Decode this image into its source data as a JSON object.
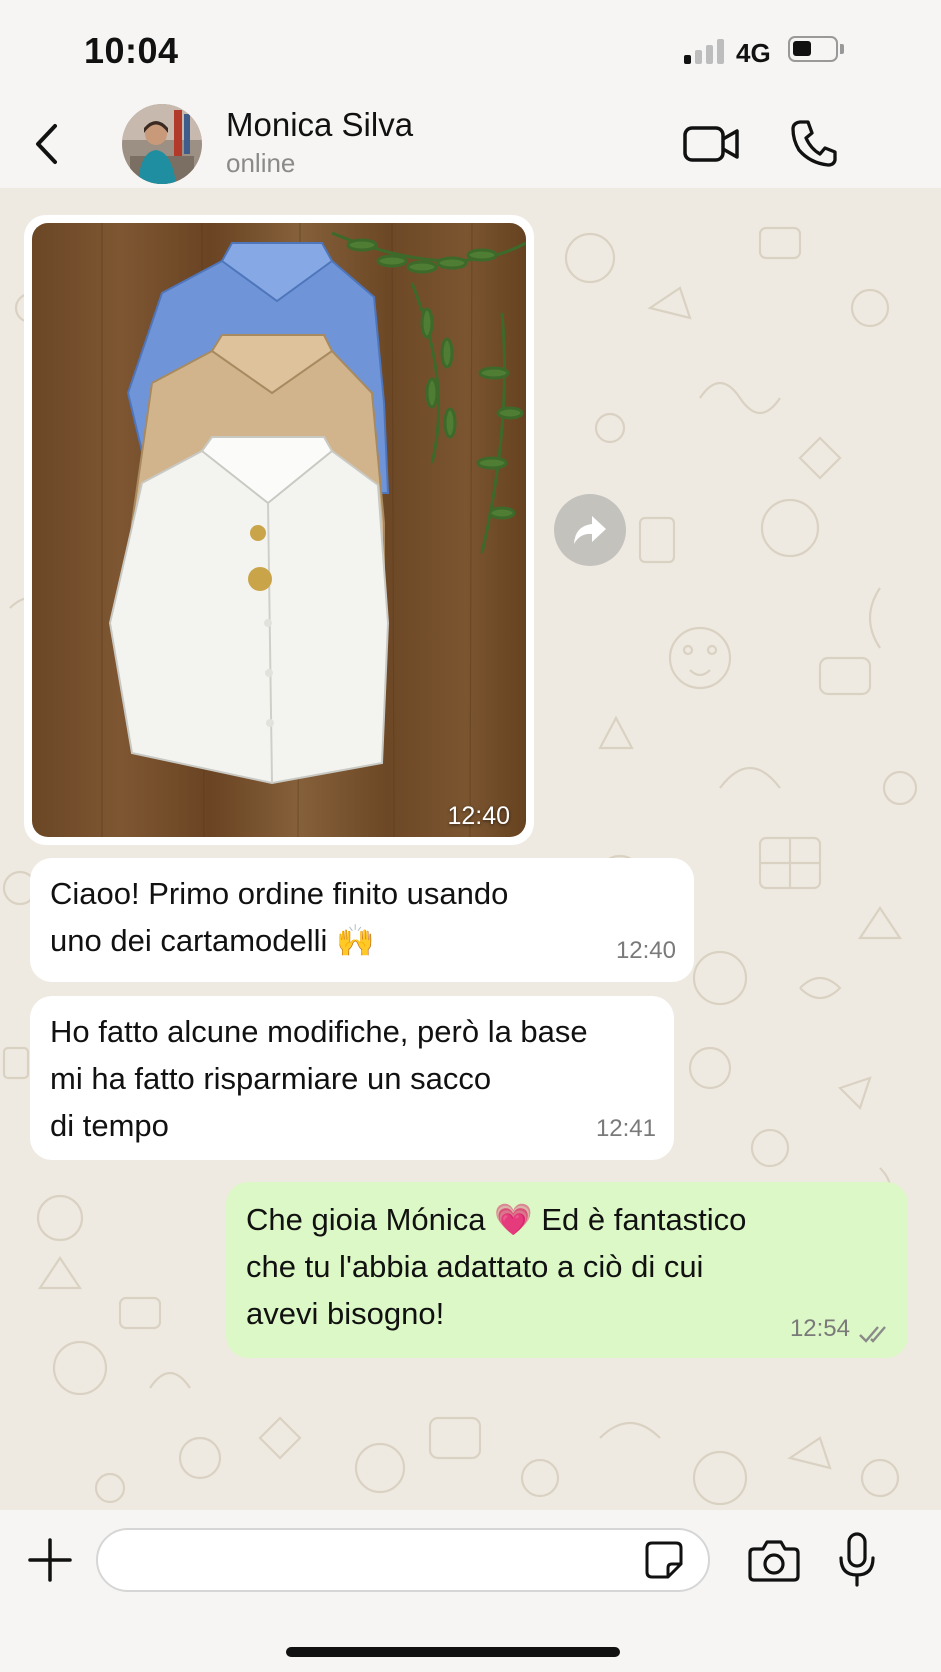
{
  "status_bar": {
    "time": "10:04",
    "network": "4G",
    "signal_bars_active": 1,
    "signal_bars_total": 4,
    "battery_level": 0.4
  },
  "header": {
    "contact_name": "Monica Silva",
    "contact_status": "online",
    "icons": [
      "chevron-left-icon",
      "video-camera-icon",
      "phone-icon"
    ]
  },
  "messages": [
    {
      "type": "image",
      "direction": "incoming",
      "time": "12:40",
      "image_subject": "three sleeveless shirts (blue, beige, white) on wooden table with fern"
    },
    {
      "type": "text",
      "direction": "incoming",
      "text": "Ciaoo! Primo ordine finito usando\nuno dei cartamodelli 🙌",
      "time": "12:40"
    },
    {
      "type": "text",
      "direction": "incoming",
      "text": "Ho fatto alcune modifiche, però la base\nmi ha fatto risparmiare un sacco\ndi tempo",
      "time": "12:41"
    },
    {
      "type": "text",
      "direction": "outgoing",
      "text": "Che gioia Mónica 💗 Ed è fantastico\nche tu l'abbia adattato a ciò di cui\navevi bisogno!",
      "time": "12:54",
      "status": "read"
    }
  ],
  "input": {
    "value": "",
    "icons": [
      "plus-icon",
      "sticker-icon",
      "camera-icon",
      "microphone-icon"
    ]
  },
  "colors": {
    "chat_background": "#efeae1",
    "incoming_bubble": "#ffffff",
    "outgoing_bubble": "#dcf8c6",
    "header_background": "#f6f5f3"
  }
}
